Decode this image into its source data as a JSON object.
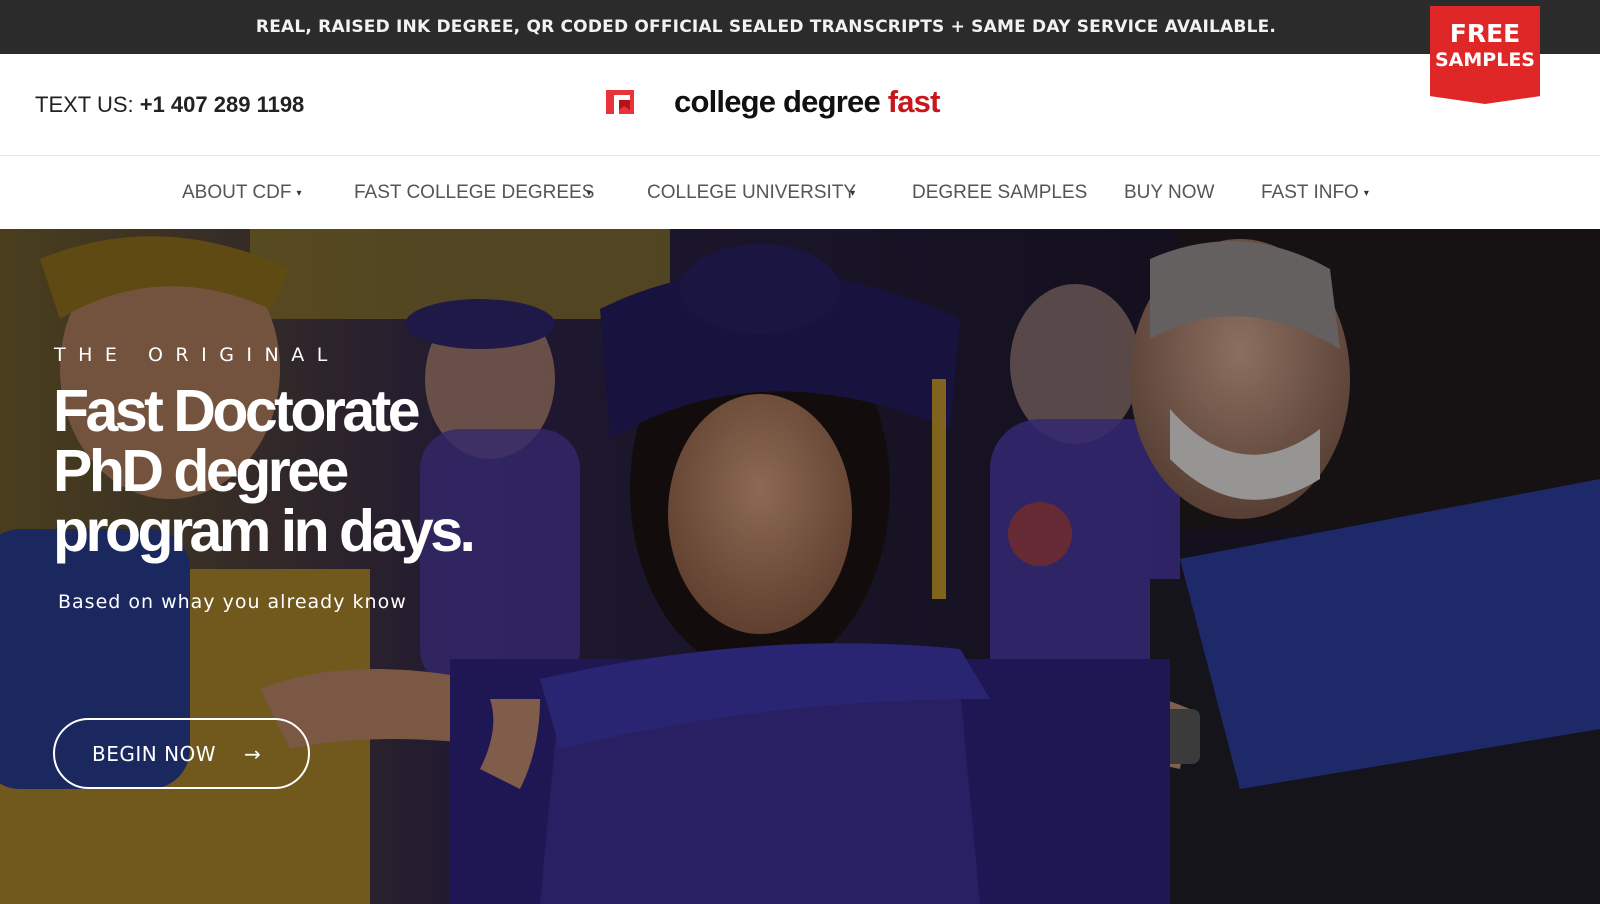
{
  "topbar": {
    "announcement": "REAL, RAISED INK DEGREE, QR CODED OFFICIAL SEALED TRANSCRIPTS + SAME DAY SERVICE AVAILABLE."
  },
  "badge": {
    "line1": "FREE",
    "line2": "SAMPLES",
    "color": "#e02727"
  },
  "header": {
    "phone_label": "TEXT US: ",
    "phone_number": "+1 407 289 1198",
    "logo_main": "college degree ",
    "logo_accent": "fast",
    "logo_accent_color": "#c8161d",
    "logo_icon": "book-flag-icon"
  },
  "nav": {
    "items": [
      {
        "label": "ABOUT CDF",
        "caret": "▾"
      },
      {
        "label": "FAST COLLEGE DEGREES",
        "caret": "▾"
      },
      {
        "label": "COLLEGE UNIVERSITY",
        "caret": "▾"
      },
      {
        "label": "DEGREE SAMPLES"
      },
      {
        "label": "BUY NOW"
      },
      {
        "label": "FAST INFO",
        "caret": "▾"
      }
    ]
  },
  "hero": {
    "eyebrow": "THE ORIGINAL",
    "headline_lines": [
      "Fast Doctorate",
      "PhD degree",
      "program in days."
    ],
    "subtext": "Based on whay you already know",
    "cta_label": "BEGIN NOW",
    "cta_icon": "→",
    "image_description_icon": "graduation-photo"
  }
}
